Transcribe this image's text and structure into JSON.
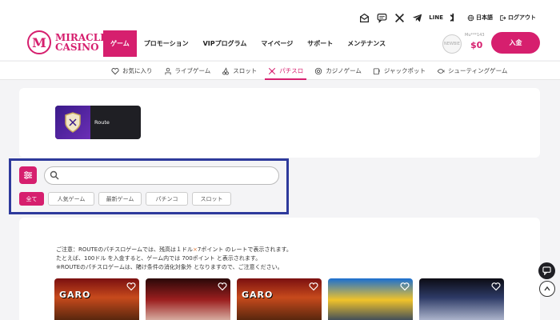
{
  "header": {
    "brand": {
      "mark": "M",
      "line1": "MIRACLE",
      "line2": "CASINO"
    },
    "utility": {
      "line_label": "LINE",
      "language_label": "日本語",
      "logout_label": "ログアウト"
    },
    "nav": [
      "ゲーム",
      "プロモーション",
      "VIPプログラム",
      "マイページ",
      "サポート",
      "メンテナンス"
    ],
    "account": {
      "badge": "NEWBIE",
      "user_id": "Mu***143",
      "balance": "$0"
    },
    "deposit_label": "入金"
  },
  "subnav": [
    "お気に入り",
    "ライブゲーム",
    "スロット",
    "パチスロ",
    "カジノゲーム",
    "ジャックポット",
    "シューティングゲーム"
  ],
  "provider": {
    "name": "Route"
  },
  "search": {
    "placeholder": "",
    "value": ""
  },
  "filters": [
    "全て",
    "人気ゲーム",
    "最新ゲーム",
    "パチンコ",
    "スロット"
  ],
  "notice": {
    "line1_a": "ご注意：ROUTEのパチスロゲームでは、残高は１ドル",
    "line1_x": "×",
    "line1_b": "7ポイント のレートで表示されます。",
    "line2": "たとえば、100ドル を入金すると、ゲーム内では 700ポイント と表示されます。",
    "line3": "※ROUTEのパチスロゲームは、賭け条件の消化対象外 となりますので、ご注意ください。"
  },
  "games": [
    {
      "title": "GARO"
    },
    {
      "title": ""
    },
    {
      "title": "GARO"
    },
    {
      "title": ""
    },
    {
      "title": ""
    }
  ],
  "colors": {
    "brand": "#d61f6e",
    "highlight": "#2e3a9c"
  }
}
